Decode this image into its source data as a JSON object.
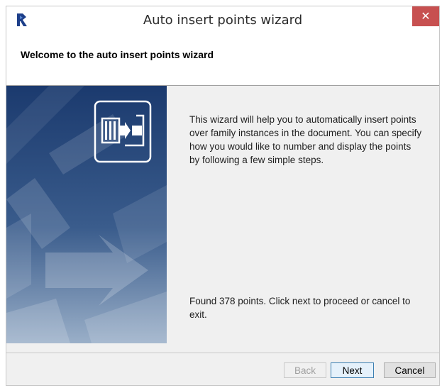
{
  "window": {
    "title": "Auto insert points wizard",
    "close_label": "✕"
  },
  "header": {
    "title": "Welcome to the auto insert points wizard"
  },
  "main": {
    "intro": "This wizard will help you to automatically insert points over family instances in the document. You can specify how you would like to number and display the points by following a few simple steps.",
    "status": "Found 378 points. Click next to proceed or cancel to exit."
  },
  "buttons": {
    "back": "Back",
    "next": "Next",
    "cancel": "Cancel"
  },
  "icons": {
    "app": "app-logo-icon",
    "feature": "insert-points-icon"
  },
  "colors": {
    "side_panel": "#1b3a6e",
    "close_button": "#c75050",
    "default_button_border": "#3c7fb1"
  }
}
